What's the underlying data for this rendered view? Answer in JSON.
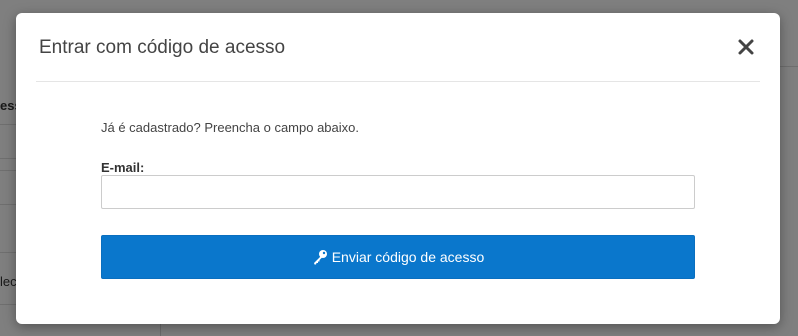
{
  "background": {
    "left_texts": [
      {
        "text": "ess",
        "bold": true
      },
      {
        "text": "lec",
        "bold": false
      }
    ]
  },
  "modal": {
    "title": "Entrar com código de acesso",
    "close_icon": "close-icon",
    "intro": "Já é cadastrado? Preencha o campo abaixo.",
    "email": {
      "label": "E-mail:",
      "value": "",
      "placeholder": ""
    },
    "send_button": {
      "label": "Enviar código de acesso",
      "icon": "key-icon",
      "color": "#0a77cc"
    }
  }
}
